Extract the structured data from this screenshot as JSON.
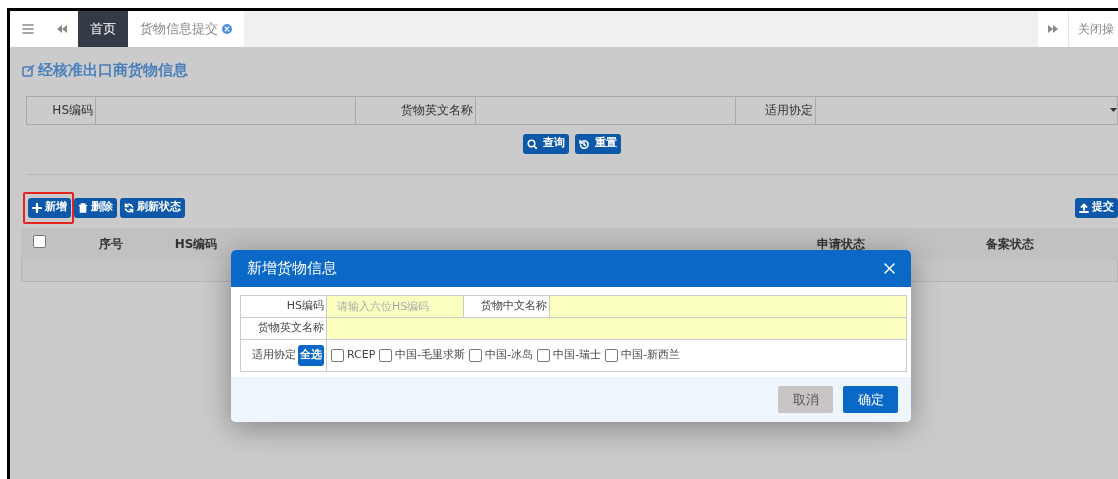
{
  "tab_bar": {
    "tabs": [
      {
        "label": "首页",
        "selected": true,
        "closable": false
      },
      {
        "label": "货物信息提交",
        "selected": false,
        "closable": true
      }
    ],
    "close_operations": "关闭操"
  },
  "page_title": "经核准出口商货物信息",
  "filters": [
    {
      "label": "HS编码",
      "kind": "text"
    },
    {
      "label": "货物英文名称",
      "kind": "text"
    },
    {
      "label": "适用协定",
      "kind": "select"
    }
  ],
  "search_buttons": [
    "查询",
    "重置"
  ],
  "toolbar": {
    "left": [
      {
        "label": "新增",
        "highlighted": true
      },
      {
        "label": "删除",
        "highlighted": false
      },
      {
        "label": "刷新状态",
        "highlighted": false
      }
    ],
    "right": [
      {
        "label": "提交",
        "highlighted": false
      }
    ]
  },
  "table": {
    "columns": [
      {
        "kind": "checkbox",
        "checked": false
      },
      {
        "kind": "text",
        "label": "序号"
      },
      {
        "kind": "text",
        "label": "HS编码"
      },
      {
        "kind": "covered"
      },
      {
        "kind": "covered"
      },
      {
        "kind": "covered"
      },
      {
        "kind": "covered"
      },
      {
        "kind": "text",
        "label": "申请状态"
      },
      {
        "kind": "text",
        "label": "备案状态"
      }
    ]
  },
  "dialog": {
    "title": "新增货物信息",
    "fields": [
      {
        "label": "HS编码",
        "placeholder": "请输入六位HS编码"
      },
      {
        "label": "货物中文名称"
      },
      {
        "label": "货物英文名称"
      }
    ],
    "agreement": {
      "label": "适用协定",
      "select_all": "全选",
      "options": [
        {
          "label": "RCEP",
          "checked": false
        },
        {
          "label": "中国-毛里求斯",
          "checked": false
        },
        {
          "label": "中国-冰岛",
          "checked": false
        },
        {
          "label": "中国-瑞士",
          "checked": false
        },
        {
          "label": "中国-新西兰",
          "checked": false
        }
      ]
    },
    "buttons": [
      {
        "label": "取消",
        "kind": "secondary"
      },
      {
        "label": "确定",
        "kind": "primary"
      }
    ]
  }
}
